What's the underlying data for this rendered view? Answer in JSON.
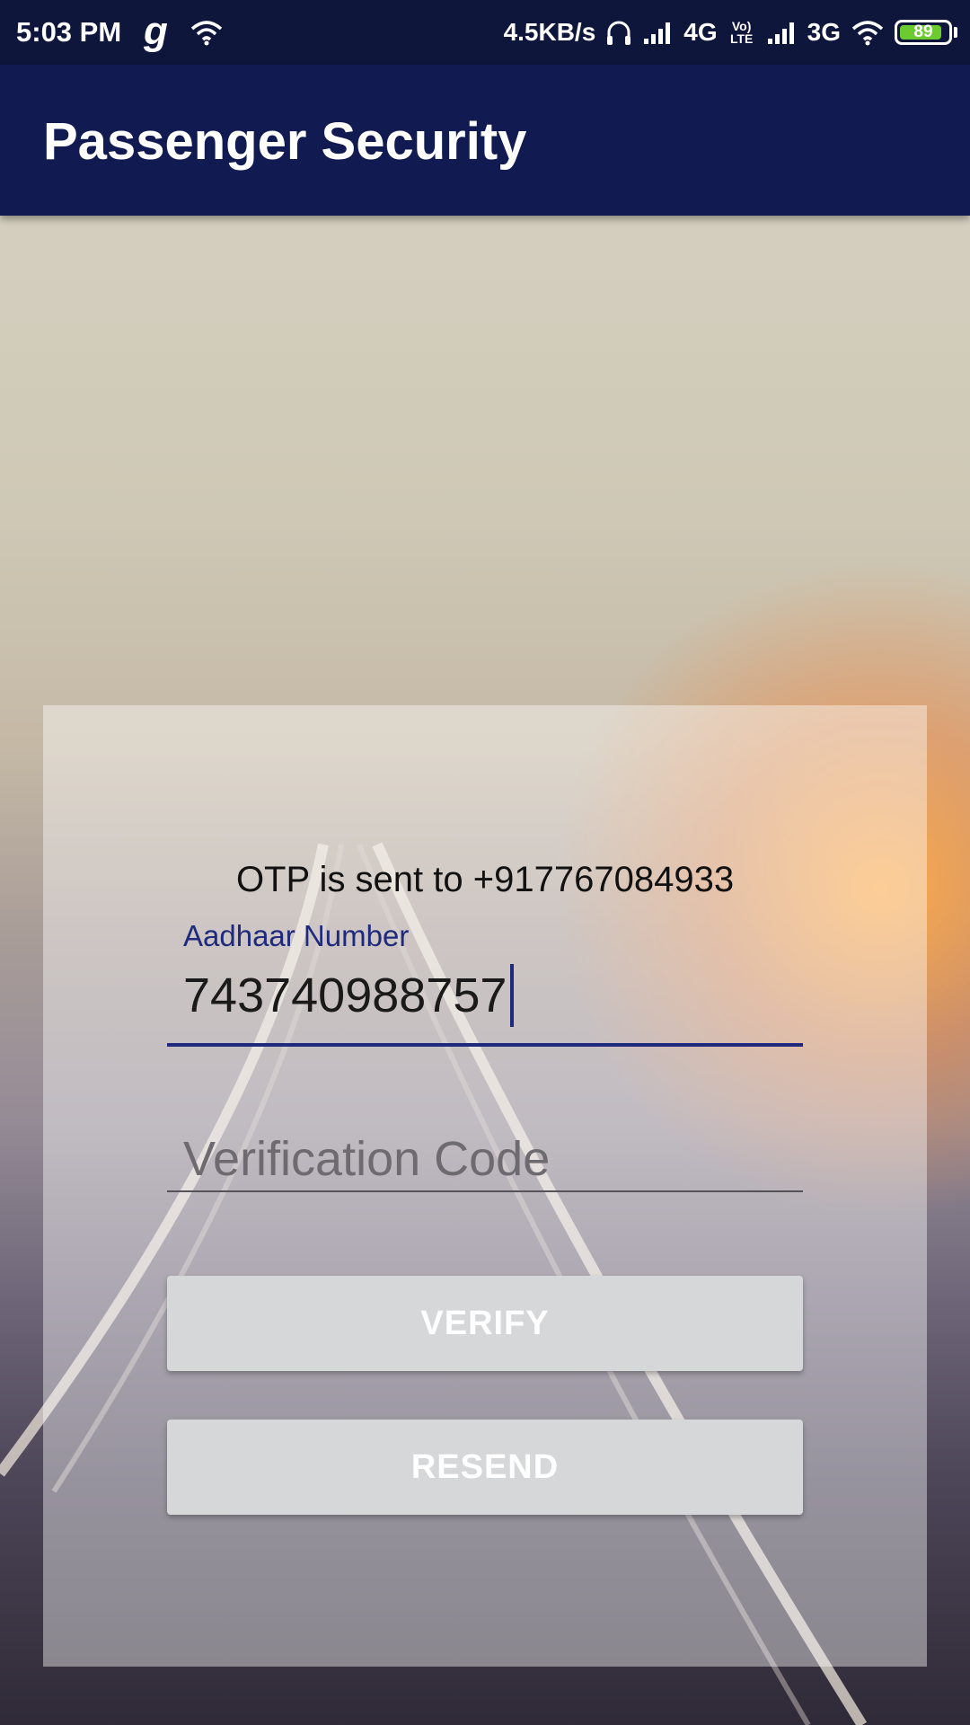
{
  "status_bar": {
    "time": "5:03 PM",
    "app_icon": "g",
    "net_speed": "4.5KB/s",
    "network_1": "4G",
    "volte": "Vo) LTE",
    "network_2": "3G",
    "battery": "89",
    "battery_level_percent": 89,
    "battery_color": "#6ccb2f"
  },
  "app_bar": {
    "title": "Passenger Security",
    "color": "#111b52"
  },
  "form": {
    "otp_message": "OTP is sent to +917767084933",
    "aadhaar_label": "Aadhaar Number",
    "aadhaar_value": "743740988757",
    "code_placeholder": "Verification Code",
    "code_value": "",
    "verify_label": "VERIFY",
    "resend_label": "RESEND",
    "accent_color": "#1f2a7d"
  },
  "icons": [
    "g-app-icon",
    "wifi-icon",
    "headphones-icon",
    "signal-icon",
    "wifi-icon",
    "battery-icon"
  ]
}
